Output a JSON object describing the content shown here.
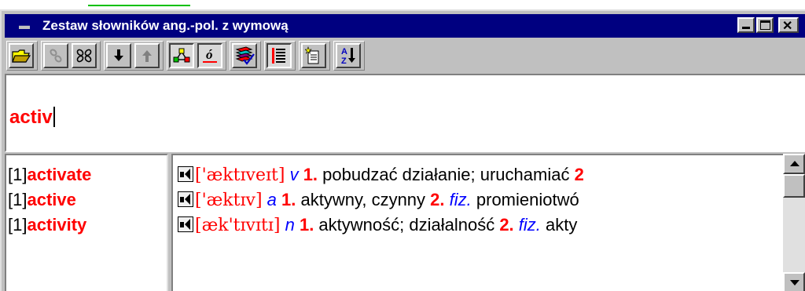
{
  "window": {
    "title": "Zestaw słowników ang.-pol. z wymową",
    "icon": "book-icon"
  },
  "toolbar": {
    "buttons": [
      {
        "name": "open-folder-icon",
        "enabled": true
      },
      {
        "name": "link-icon",
        "enabled": false
      },
      {
        "name": "unlink-icon",
        "enabled": true
      },
      {
        "name": "arrow-down-icon",
        "enabled": true
      },
      {
        "name": "arrow-up-icon",
        "enabled": false
      },
      {
        "name": "hierarchy-icon",
        "enabled": true,
        "pressed": true
      },
      {
        "name": "accent-letter-icon",
        "label": "ó",
        "enabled": true,
        "pressed": true
      },
      {
        "name": "dictionary-books-icon",
        "enabled": true
      },
      {
        "name": "list-icon",
        "enabled": true,
        "pressed": true
      },
      {
        "name": "new-document-icon",
        "enabled": true
      },
      {
        "name": "sort-az-icon",
        "label_top": "A",
        "label_bottom": "Z",
        "enabled": true
      }
    ]
  },
  "search": {
    "value": "activ"
  },
  "wordlist": {
    "items": [
      {
        "num": "[1]",
        "word": "activate"
      },
      {
        "num": "[1]",
        "word": "active"
      },
      {
        "num": "[1]",
        "word": "activity"
      }
    ]
  },
  "definitions": [
    {
      "phonetic": "['æktɪveɪt]",
      "pos": "v",
      "n1": "1.",
      "text1": " pobudzać działanie; uruchamiać ",
      "n2": "2",
      "domain": "",
      "text2": ""
    },
    {
      "phonetic": "['æktɪv]",
      "pos": "a",
      "n1": "1.",
      "text1": " aktywny, czynny ",
      "n2": "2.",
      "domain": "fiz.",
      "text2": " promieniotwó"
    },
    {
      "phonetic": "[æk'tɪvɪtɪ]",
      "pos": "n",
      "n1": "1.",
      "text1": " aktywność; działalność ",
      "n2": "2.",
      "domain": "fiz.",
      "text2": " akty"
    }
  ],
  "colors": {
    "titlebar": "#000080",
    "headword": "#ff0000",
    "pos": "#0000ff",
    "chrome": "#c0c0c0"
  }
}
